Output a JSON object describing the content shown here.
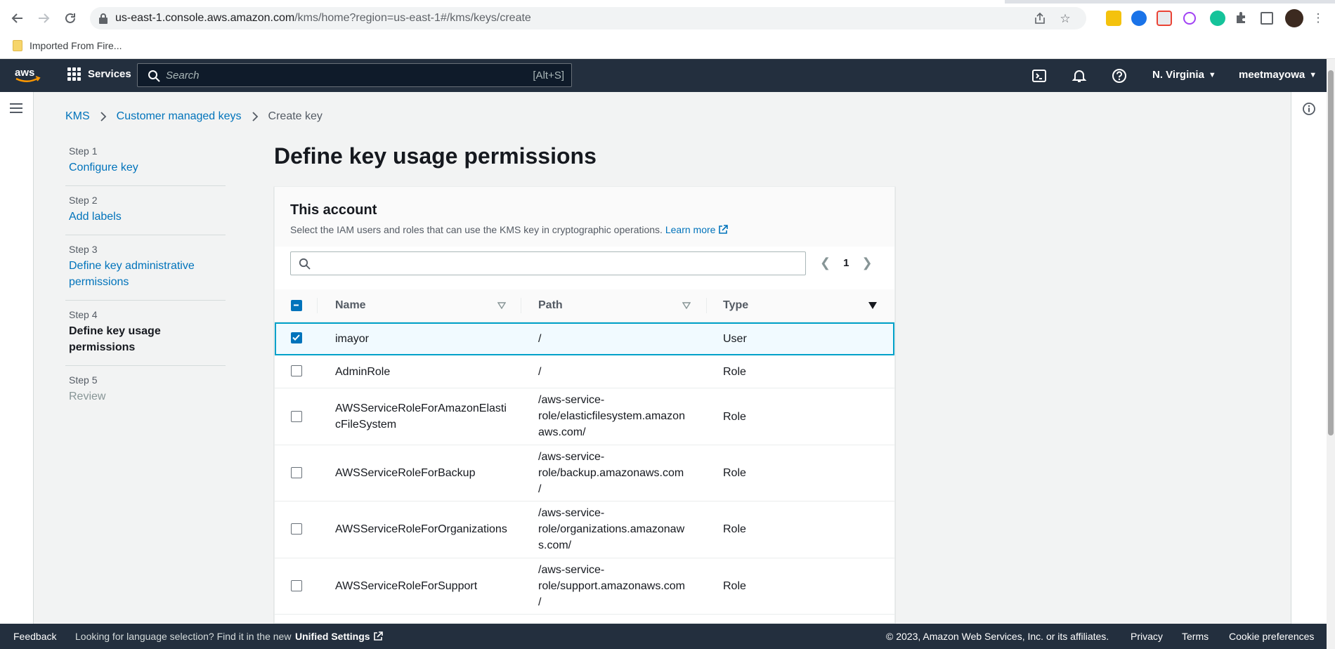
{
  "browser": {
    "url_host": "us-east-1.console.aws.amazon.com",
    "url_path": "/kms/home?region=us-east-1#/kms/keys/create",
    "bookmark": "Imported From Fire..."
  },
  "topnav": {
    "services_label": "Services",
    "search_placeholder": "Search",
    "search_shortcut": "[Alt+S]",
    "region": "N. Virginia",
    "account": "meetmayowa"
  },
  "breadcrumb": {
    "items": [
      "KMS",
      "Customer managed keys"
    ],
    "current": "Create key"
  },
  "steps": [
    {
      "num": "Step 1",
      "label": "Configure key",
      "state": "link"
    },
    {
      "num": "Step 2",
      "label": "Add labels",
      "state": "link"
    },
    {
      "num": "Step 3",
      "label": "Define key administrative permissions",
      "state": "link"
    },
    {
      "num": "Step 4",
      "label": "Define key usage permissions",
      "state": "active"
    },
    {
      "num": "Step 5",
      "label": "Review",
      "state": "disabled"
    }
  ],
  "page_title": "Define key usage permissions",
  "panel": {
    "title": "This account",
    "description": "Select the IAM users and roles that can use the KMS key in cryptographic operations.",
    "learn_more": "Learn more",
    "page_number": "1"
  },
  "table": {
    "columns": [
      "Name",
      "Path",
      "Type"
    ],
    "rows": [
      {
        "name": "imayor",
        "path": "/",
        "type": "User",
        "checked": true
      },
      {
        "name": "AdminRole",
        "path": "/",
        "type": "Role",
        "checked": false
      },
      {
        "name": "AWSServiceRoleForAmazonElasticFileSystem",
        "name_lines": [
          "AWSServiceRoleForAmazonElasti",
          "cFileSystem"
        ],
        "path_lines": [
          "/aws-service-",
          "role/elasticfilesystem.amazon",
          "aws.com/"
        ],
        "path": "/aws-service-role/elasticfilesystem.amazonaws.com/",
        "type": "Role",
        "checked": false
      },
      {
        "name": "AWSServiceRoleForBackup",
        "path_lines": [
          "/aws-service-",
          "role/backup.amazonaws.com",
          "/"
        ],
        "path": "/aws-service-role/backup.amazonaws.com/",
        "type": "Role",
        "checked": false
      },
      {
        "name": "AWSServiceRoleForOrganizations",
        "path_lines": [
          "/aws-service-",
          "role/organizations.amazonaw",
          "s.com/"
        ],
        "path": "/aws-service-role/organizations.amazonaws.com/",
        "type": "Role",
        "checked": false
      },
      {
        "name": "AWSServiceRoleForSupport",
        "path_lines": [
          "/aws-service-",
          "role/support.amazonaws.com",
          "/"
        ],
        "path": "/aws-service-role/support.amazonaws.com/",
        "type": "Role",
        "checked": false
      }
    ]
  },
  "footer": {
    "feedback": "Feedback",
    "language_text": "Looking for language selection? Find it in the new",
    "unified_settings": "Unified Settings",
    "copyright": "© 2023, Amazon Web Services, Inc. or its affiliates.",
    "privacy": "Privacy",
    "terms": "Terms",
    "cookie": "Cookie preferences"
  },
  "colors": {
    "aws_nav": "#232f3e",
    "link": "#0073bb",
    "selected_row_border": "#00a1c9",
    "aws_orange": "#ff9900"
  }
}
